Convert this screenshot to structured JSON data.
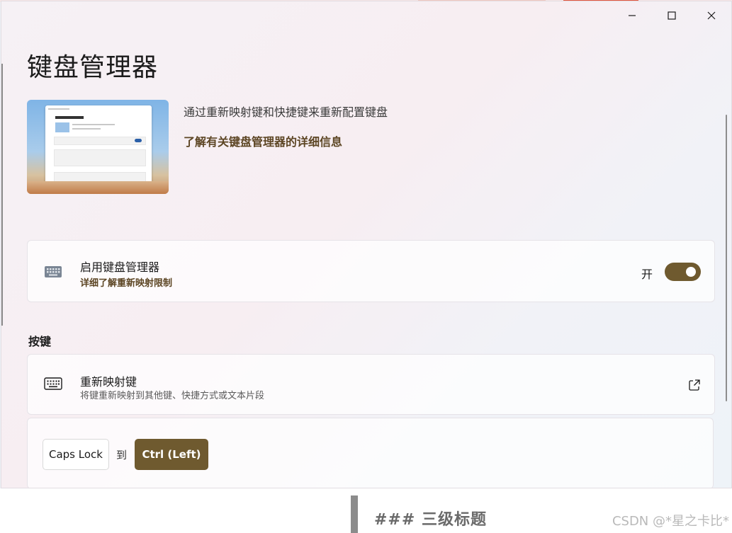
{
  "window": {
    "title": "键盘管理器",
    "controls": {
      "minimize": "minimize",
      "maximize": "maximize",
      "close": "close"
    }
  },
  "intro": {
    "description": "通过重新映射键和快捷键来重新配置键盘",
    "learn_more": "了解有关键盘管理器的详细信息",
    "image_title": "Keyboard Manager"
  },
  "enable_card": {
    "icon": "keyboard-icon",
    "title": "启用键盘管理器",
    "subtitle_link": "详细了解重新映射限制",
    "toggle_state_label": "开",
    "toggle_on": true
  },
  "keys_section": {
    "heading": "按键",
    "remap_card": {
      "icon": "keyboard-icon",
      "title": "重新映射键",
      "subtitle": "将键重新映射到其他键、快捷方式或文本片段",
      "action_icon": "open-external-icon"
    },
    "mapping": {
      "from_key": "Caps Lock",
      "to_label": "到",
      "to_key": "Ctrl (Left)"
    }
  },
  "background": {
    "heading_fragment": "### 三级标题",
    "watermark": "CSDN @*星之卡比*"
  },
  "colors": {
    "accent": "#6f5a2f",
    "link": "#5c4523"
  }
}
